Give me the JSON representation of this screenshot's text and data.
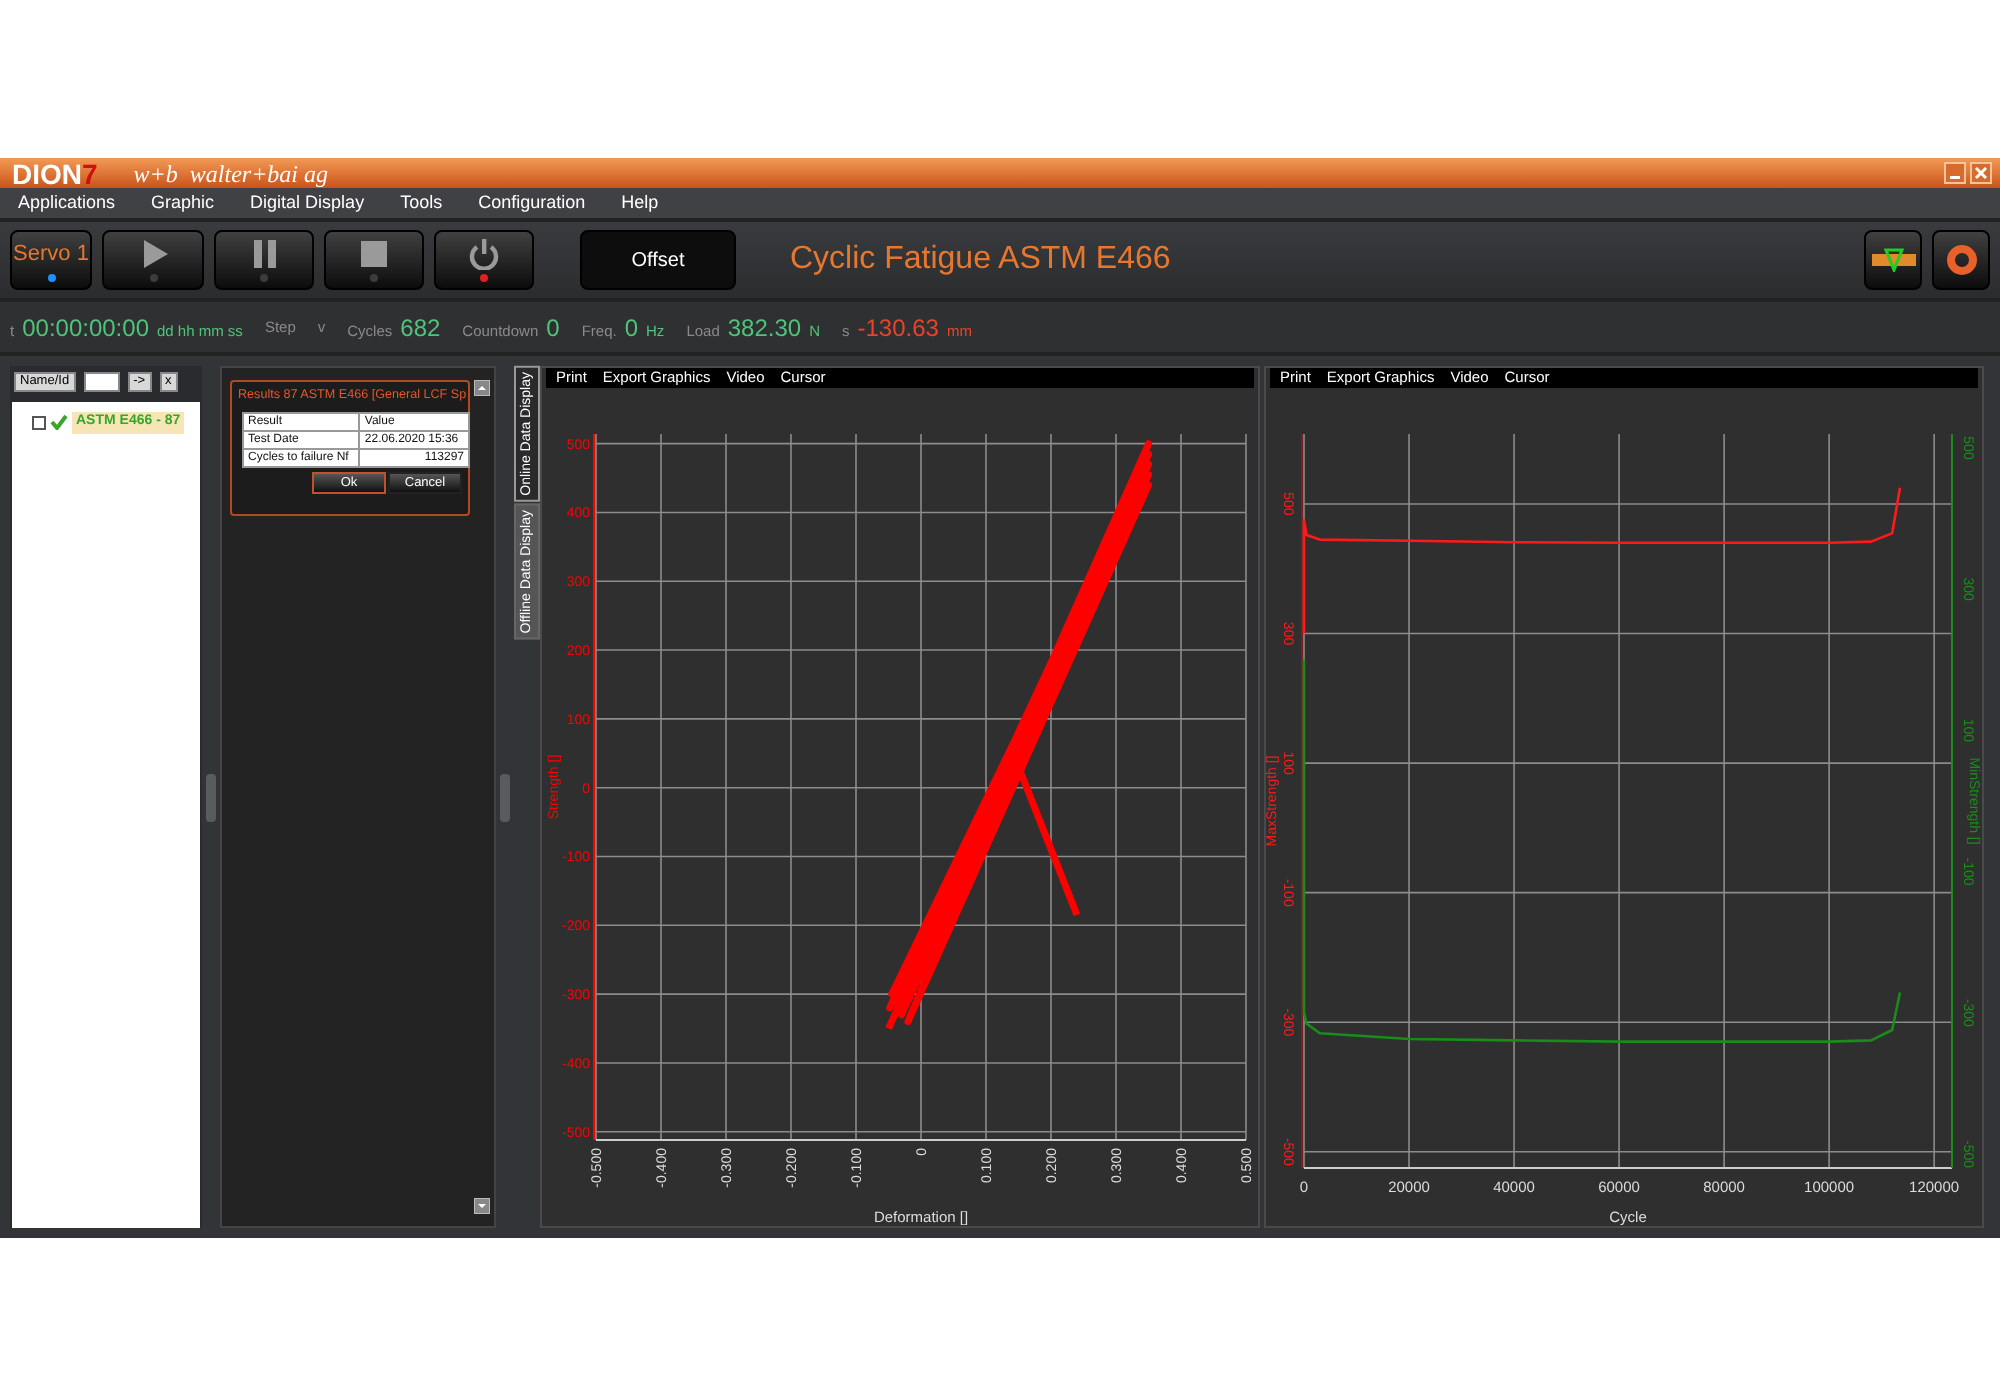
{
  "title_bar": {
    "logo": {
      "main": "DION",
      "accent": "7"
    },
    "company": "w+b  walter+bai ag",
    "buttons": [
      {
        "kind": "minimize"
      },
      {
        "kind": "close"
      }
    ]
  },
  "menu": [
    "Applications",
    "Graphic",
    "Digital Display",
    "Tools",
    "Configuration",
    "Help"
  ],
  "toolbar": {
    "buttons": [
      {
        "kind": "servo",
        "label": "Servo 1",
        "color": "#1e90ff"
      },
      {
        "kind": "play",
        "color": "#3c3c3c"
      },
      {
        "kind": "pause",
        "color": "#3c3c3c"
      },
      {
        "kind": "stop",
        "color": "#3c3c3c"
      },
      {
        "kind": "power",
        "color": "#e02020"
      },
      {
        "kind": "offset",
        "label": "Offset"
      }
    ],
    "title": "Cyclic Fatigue ASTM E466",
    "tools": [
      {
        "kind": "shield"
      },
      {
        "kind": "ring"
      }
    ]
  },
  "readouts": [
    {
      "label": "t",
      "value": "00:00:00:00",
      "unit": "dd hh mm ss",
      "color": "#4fc47a"
    },
    {
      "label": "Step"
    },
    {
      "label": "v"
    },
    {
      "label": "Cycles",
      "value": "682",
      "color": "#4fc47a"
    },
    {
      "label": "Countdown",
      "value": "0",
      "color": "#4fc47a"
    },
    {
      "label": "Freq.",
      "value": "0",
      "unit": "Hz",
      "color": "#4fc47a"
    },
    {
      "label": "Load",
      "value": "382.30",
      "unit": "N",
      "color": "#4fc47a"
    },
    {
      "label": "s",
      "value": "-130.63",
      "unit": "mm",
      "color": "#e8442a"
    }
  ],
  "browser": {
    "search_button": "Name/Id",
    "go_button": "->",
    "clear_button": "x",
    "tree": [
      {
        "label": "ASTM E466 - 87",
        "checked": false,
        "passed": true,
        "selected": true
      }
    ]
  },
  "results_dialog": {
    "title": "Results 87 ASTM E466 [General LCF Sp",
    "columns": [
      "Result",
      "Value"
    ],
    "rows": [
      [
        "Test Date",
        "22.06.2020 15:36"
      ],
      [
        "Cycles to failure Nf",
        "113297"
      ]
    ],
    "buttons": [
      {
        "label": "Ok",
        "focused": true
      },
      {
        "label": "Cancel",
        "focused": false
      }
    ]
  },
  "view_tabs": [
    {
      "label": "Online Data Display",
      "selected": true
    },
    {
      "label": "Offline Data Display",
      "selected": false
    }
  ],
  "charts": [
    {
      "menu": [
        "Print",
        "Export Graphics",
        "Video",
        "Cursor"
      ],
      "chart_data": {
        "type": "line",
        "xlabel": "Deformation []",
        "ylabel": "Strength []",
        "x": [
          -0.05,
          0.35,
          -0.02,
          0.35,
          -0.045,
          0.35,
          -0.03,
          0.35,
          -0.048,
          0.35,
          -0.035,
          0.15,
          0.24
        ],
        "series": [
          {
            "color": "#ff0000",
            "values": [
              -350,
              500,
              -340,
              440,
              -300,
              470,
              -330,
              455,
              -320,
              485,
              -315,
              30,
              -185
            ]
          }
        ],
        "xlim": [
          -0.5,
          0.5
        ],
        "ylim": [
          -512,
          514
        ],
        "xticks": [
          {
            "value": -0.5,
            "label": "-0.500"
          },
          {
            "value": -0.4,
            "label": "-0.400"
          },
          {
            "value": -0.3,
            "label": "-0.300"
          },
          {
            "value": -0.2,
            "label": "-0.200"
          },
          {
            "value": -0.1,
            "label": "-0.100"
          },
          {
            "value": 0,
            "label": "0"
          },
          {
            "value": 0.1,
            "label": "0.100"
          },
          {
            "value": 0.2,
            "label": "0.200"
          },
          {
            "value": 0.3,
            "label": "0.300"
          },
          {
            "value": 0.4,
            "label": "0.400"
          },
          {
            "value": 0.5,
            "label": "0.500"
          }
        ],
        "yticks": [
          -500,
          -400,
          -300,
          -200,
          -100,
          0,
          100,
          200,
          300,
          400,
          500
        ],
        "grid": true
      }
    },
    {
      "menu": [
        "Print",
        "Export Graphics",
        "Video",
        "Cursor"
      ],
      "right_axis": {
        "label": "MinStrength []",
        "ticks": [
          "500",
          "300",
          "100",
          "-100",
          "-300",
          "-500"
        ]
      },
      "chart_data": {
        "type": "line",
        "xlabel": "Cycle",
        "ylabel": "MaxStrength []",
        "x": [
          0,
          0,
          500,
          3000,
          20000,
          40000,
          60000,
          80000,
          100000,
          108000,
          112000,
          113500
        ],
        "series": [
          {
            "color": "#ff1a1a",
            "values": [
              300,
              475,
              452,
              445,
              443,
              441,
              440,
              440,
              440,
              442,
              455,
              525
            ]
          },
          {
            "color": "#1a8c1a",
            "values": [
              260,
              -285,
              -302,
              -317,
              -326,
              -328,
              -330,
              -330,
              -330,
              -328,
              -312,
              -254
            ]
          }
        ],
        "xlim": [
          0,
          123400
        ],
        "ylim": [
          -525,
          608
        ],
        "xticks": [
          0,
          20000,
          40000,
          60000,
          80000,
          100000,
          120000
        ],
        "yticks": [
          -500,
          -300,
          -100,
          100,
          300,
          500
        ],
        "grid": true
      }
    }
  ]
}
